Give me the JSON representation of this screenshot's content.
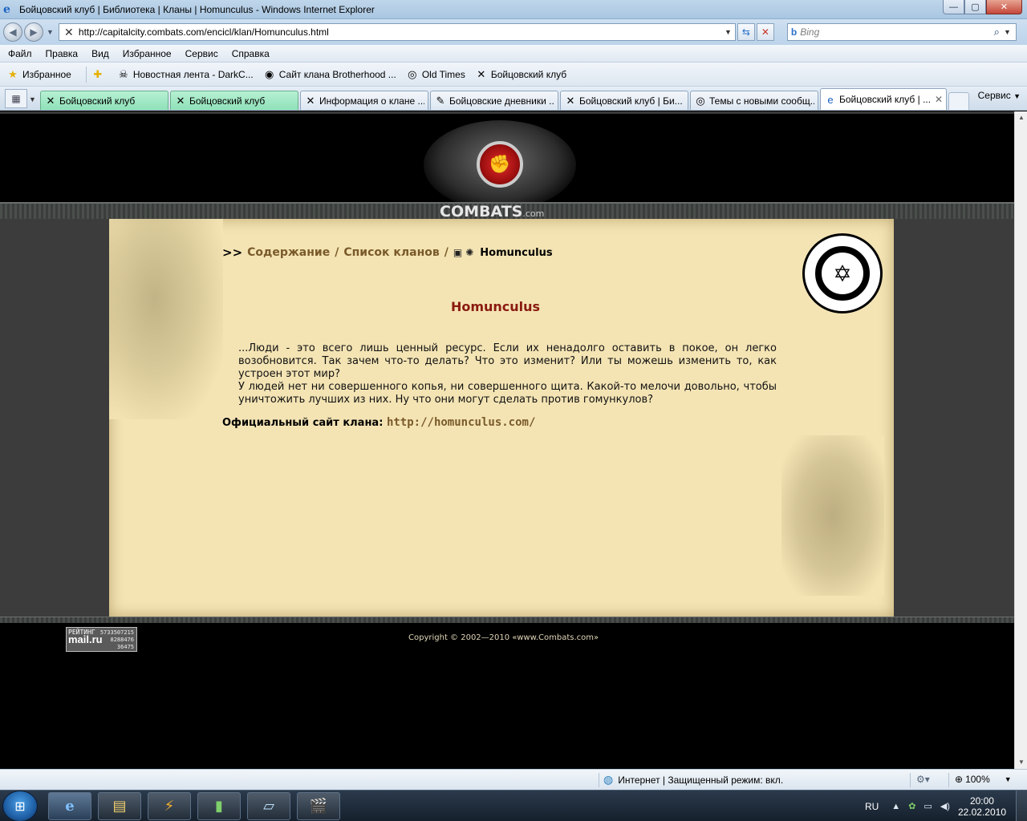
{
  "window": {
    "title": "Бойцовский клуб | Библиотека | Кланы | Homunculus - Windows Internet Explorer",
    "min": "—",
    "max": "▢",
    "close": "✕"
  },
  "address": {
    "url": "http://capitalcity.combats.com/encicl/klan/Homunculus.html",
    "search_placeholder": "Bing"
  },
  "menu": [
    "Файл",
    "Правка",
    "Вид",
    "Избранное",
    "Сервис",
    "Справка"
  ],
  "favorites": {
    "label": "Избранное",
    "items": [
      {
        "label": "Новостная лента - DarkC...",
        "icon": "skull-icon"
      },
      {
        "label": "Сайт клана Brotherhood ...",
        "icon": "emblem-icon"
      },
      {
        "label": "Old Times",
        "icon": "emblem-icon"
      },
      {
        "label": "Бойцовский клуб",
        "icon": "swords-icon"
      }
    ]
  },
  "tabs": [
    {
      "label": "Бойцовский клуб",
      "style": "green"
    },
    {
      "label": "Бойцовский клуб",
      "style": "green"
    },
    {
      "label": "Информация о клане ...",
      "style": "normal"
    },
    {
      "label": "Бойцовские дневники ...",
      "style": "normal"
    },
    {
      "label": "Бойцовский клуб | Би...",
      "style": "normal"
    },
    {
      "label": "Темы с новыми сообщ...",
      "style": "normal"
    },
    {
      "label": "Бойцовский клуб | ...",
      "style": "active"
    }
  ],
  "tools_label": "Сервис",
  "page": {
    "breadcrumb": {
      "prefix": ">>",
      "contents": "Содержание",
      "sep": "/",
      "clan_list": "Список кланов",
      "current": "Homunculus"
    },
    "clan_name": "Homunculus",
    "description": [
      "...Люди - это всего лишь ценный ресурс. Если их ненадолго оставить в покое, он легко возобновится. Так зачем что-то делать? Что это изменит? Или ты можешь изменить то, как устроен этот мир?",
      "У людей нет ни совершенного копья, ни совершенного щита. Какой-то мелочи довольно, чтобы уничтожить лучших из них. Ну что они могут сделать против гомункулов?"
    ],
    "official_label": "Официальный сайт клана:",
    "official_url": "http://homunculus.com/",
    "banner_text": "COMBATS",
    "banner_suffix": ".com",
    "copyright": "Copyright © 2002—2010 «www.Combats.com»",
    "counter": {
      "label": "РЕЙТИНГ",
      "brand": "mail.ru",
      "n1": "5733507215",
      "n2": "8288476",
      "n3": "36475"
    }
  },
  "status": {
    "zone": "Интернет | Защищенный режим: вкл.",
    "zoom": "100%"
  },
  "taskbar": {
    "lang": "RU",
    "time": "20:00",
    "date": "22.02.2010"
  }
}
